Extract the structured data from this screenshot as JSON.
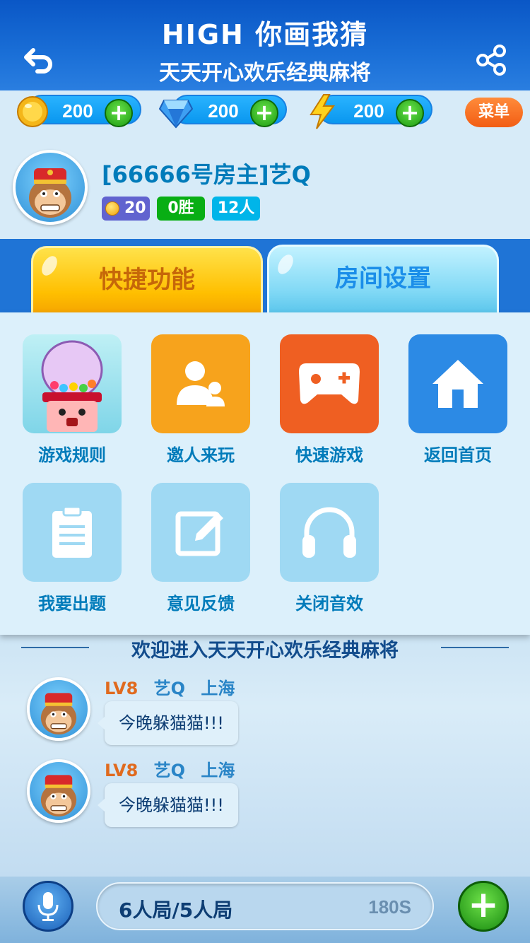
{
  "header": {
    "title": "HIGH 你画我猜",
    "subtitle": "天天开心欢乐经典麻将",
    "color": "#1a6fd7"
  },
  "currency": {
    "coins": "200",
    "diamonds": "200",
    "energy": "200",
    "menu_label": "菜单",
    "plus_symbol": "+"
  },
  "user": {
    "name": "[66666号房主]艺Q",
    "coins": "20",
    "wins": "0胜",
    "people": "12人",
    "name_color": "#007bba"
  },
  "tabs": [
    {
      "label": "快捷功能",
      "active": true,
      "color": "#c66709"
    },
    {
      "label": "房间设置",
      "active": false,
      "color": "#1b8ee9"
    }
  ],
  "functions": [
    {
      "label": "游戏规则",
      "icon": "gumball-game-icon"
    },
    {
      "label": "邀人来玩",
      "icon": "invite-people-icon"
    },
    {
      "label": "快速游戏",
      "icon": "gamepad-icon"
    },
    {
      "label": "返回首页",
      "icon": "home-icon"
    },
    {
      "label": "我要出题",
      "icon": "clipboard-icon"
    },
    {
      "label": "意见反馈",
      "icon": "edit-icon"
    },
    {
      "label": "关闭音效",
      "icon": "headphones-icon"
    }
  ],
  "chat": {
    "welcome": "欢迎进入天天开心欢乐经典麻将",
    "messages": [
      {
        "level": "LV8",
        "name": "艺Q",
        "location": "上海",
        "text": "今晚躲猫猫!!!"
      },
      {
        "level": "LV8",
        "name": "艺Q",
        "location": "上海",
        "text": "今晚躲猫猫!!!"
      }
    ]
  },
  "bottom": {
    "mode": "6人局/5人局",
    "timer": "180S",
    "add_symbol": "+"
  }
}
